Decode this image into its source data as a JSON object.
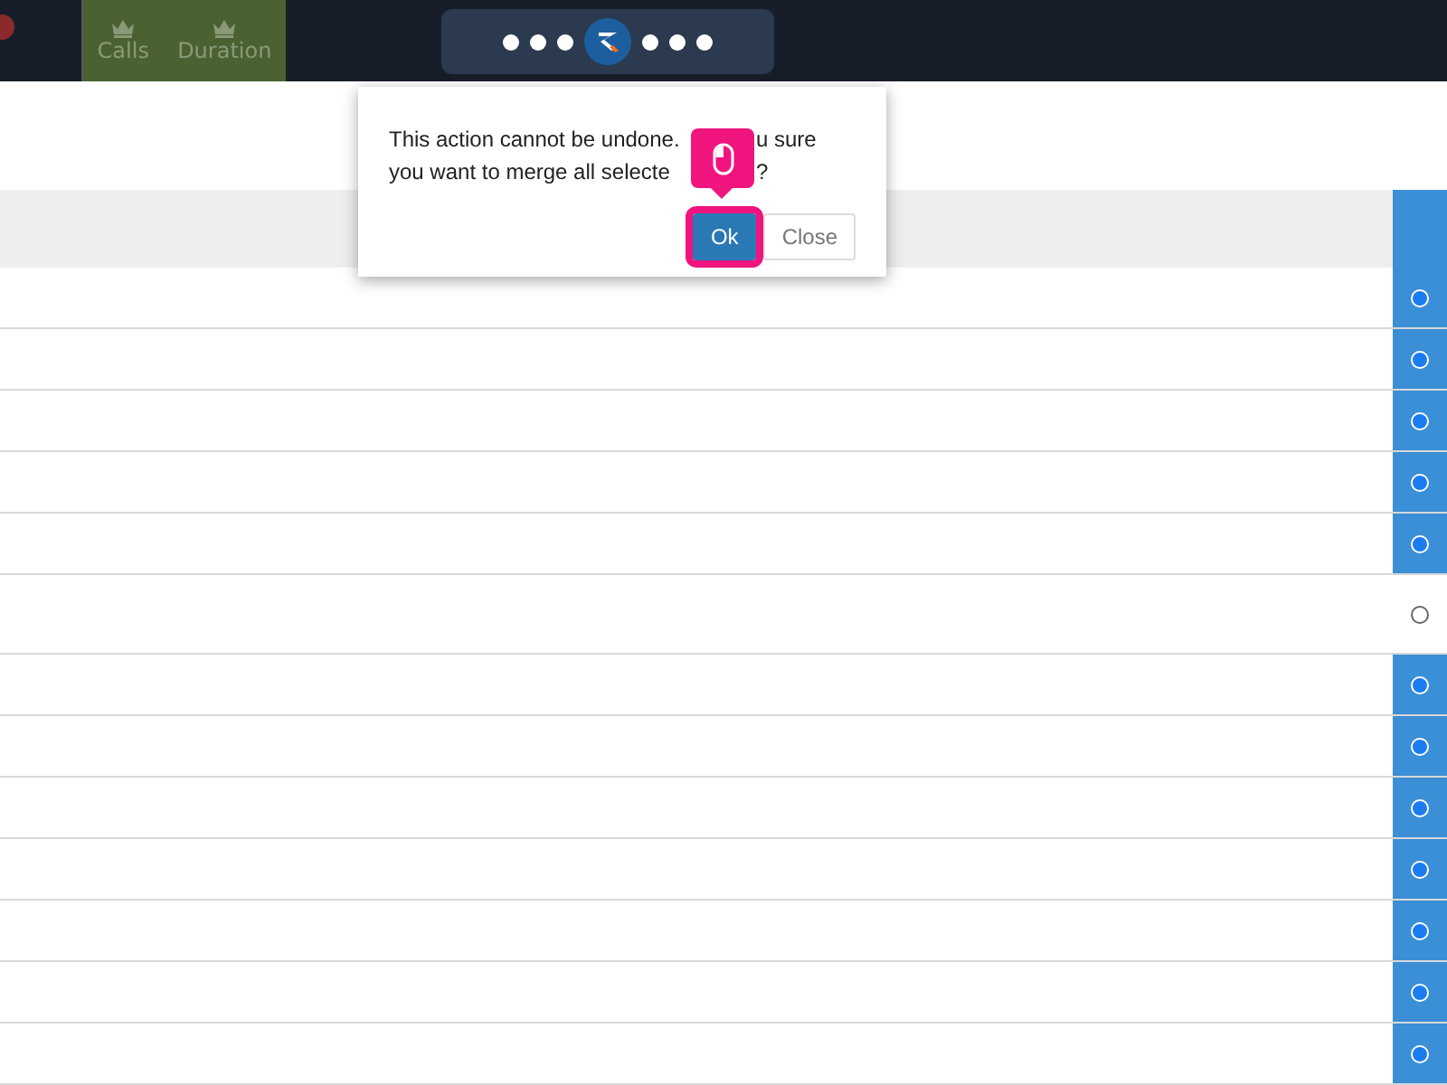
{
  "toolbar": {
    "stats": [
      {
        "label": "Calls"
      },
      {
        "label": "Duration"
      }
    ]
  },
  "table": {
    "rows": [
      {
        "selected": true
      },
      {
        "selected": true
      },
      {
        "selected": true
      },
      {
        "selected": true
      },
      {
        "selected": true
      },
      {
        "selected": false
      },
      {
        "selected": true
      },
      {
        "selected": true
      },
      {
        "selected": true
      },
      {
        "selected": true
      },
      {
        "selected": true
      },
      {
        "selected": true
      },
      {
        "selected": true
      }
    ]
  },
  "dialog": {
    "lines": [
      [
        "This action cannot be undone.",
        "u sure"
      ],
      [
        "you want to merge all selecte",
        "?"
      ]
    ],
    "buttons": [
      {
        "label": "Ok",
        "kind": "primary"
      },
      {
        "label": "Close",
        "kind": "secondary"
      }
    ]
  }
}
